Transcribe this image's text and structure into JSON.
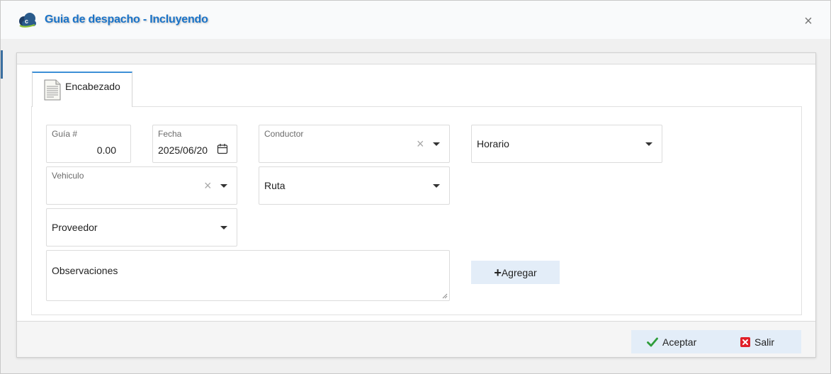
{
  "dialog": {
    "title": "Guia de despacho - Incluyendo",
    "logo_icon": "cloud-logo-icon",
    "close_icon": "close-icon"
  },
  "tabs": [
    {
      "label": "Encabezado",
      "icon": "document-icon"
    }
  ],
  "form": {
    "guia": {
      "label": "Guía #",
      "value": "0.00"
    },
    "fecha": {
      "label": "Fecha",
      "value": "2025/06/20",
      "icon": "calendar-icon"
    },
    "conductor": {
      "label": "Conductor",
      "value": ""
    },
    "horario": {
      "placeholder": "Horario"
    },
    "vehiculo": {
      "label": "Vehiculo",
      "value": ""
    },
    "ruta": {
      "placeholder": "Ruta"
    },
    "proveedor": {
      "placeholder": "Proveedor"
    },
    "observaciones": {
      "placeholder": "Observaciones"
    },
    "agregar_button": {
      "label": "Agregar",
      "icon": "plus-icon"
    }
  },
  "footer": {
    "aceptar": {
      "label": "Aceptar",
      "icon": "check-icon",
      "color": "#2e9d3a"
    },
    "salir": {
      "label": "Salir",
      "icon": "close-box-icon",
      "color": "#e0202a"
    }
  },
  "colors": {
    "accent": "#1a73c8",
    "tab_border": "#3d8fd6",
    "button_bg": "#e3edf8"
  }
}
